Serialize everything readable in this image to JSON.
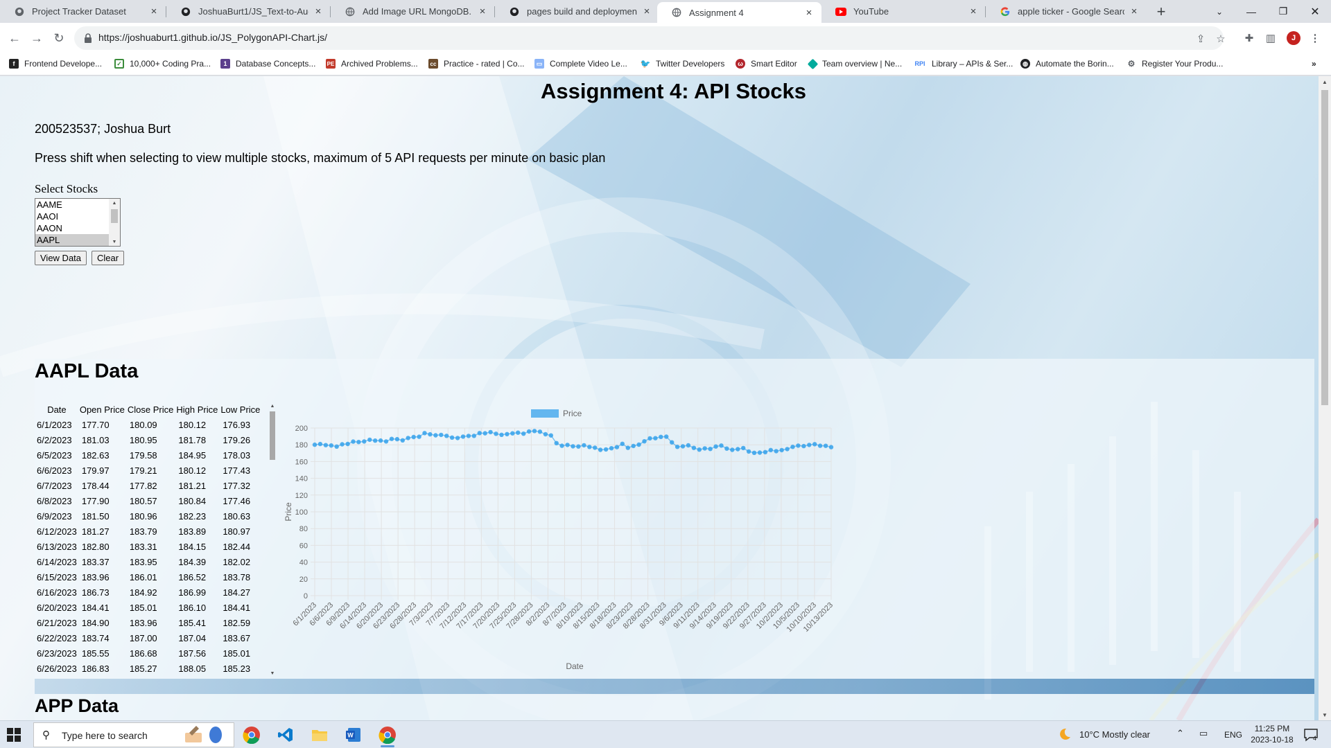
{
  "browser": {
    "tabs": [
      {
        "title": "Project Tracker Dataset",
        "icon": "github-icon"
      },
      {
        "title": "JoshuaBurt1/JS_Text-to-Audio:",
        "icon": "github-icon"
      },
      {
        "title": "Add Image URL MongoDB.",
        "icon": "globe-icon"
      },
      {
        "title": "pages build and deployment · J",
        "icon": "github-icon"
      },
      {
        "title": "Assignment 4",
        "icon": "globe-icon"
      },
      {
        "title": "YouTube",
        "icon": "youtube-icon"
      },
      {
        "title": "apple ticker - Google Search",
        "icon": "google-icon"
      }
    ],
    "active_tab_index": 4,
    "url": "https://joshuaburt1.github.io/JS_PolygonAPI-Chart.js/",
    "profile_initial": "J",
    "bookmarks": [
      "Frontend Develope...",
      "10,000+ Coding Pra...",
      "Database Concepts...",
      "Archived Problems...",
      "Practice - rated | Co...",
      "Complete Video Le...",
      "Twitter Developers",
      "Smart Editor",
      "Team overview | Ne...",
      "Library – APIs & Ser...",
      "Automate the Borin...",
      "Register Your Produ..."
    ]
  },
  "page": {
    "title": "Assignment 4: API Stocks",
    "student": "200523537; Joshua Burt",
    "instructions": "Press shift when selecting to view multiple stocks, maximum of 5 API requests per minute on basic plan",
    "select_label": "Select Stocks",
    "stock_options": [
      "AAME",
      "AAOI",
      "AAON",
      "AAPL"
    ],
    "selected_option": "AAPL",
    "view_button": "View Data",
    "clear_button": "Clear",
    "section_title": "AAPL Data",
    "next_section_title": "APP Data",
    "table": {
      "headers": [
        "Date",
        "Open Price",
        "Close Price",
        "High Price",
        "Low Price"
      ],
      "rows": [
        [
          "6/1/2023",
          "177.70",
          "180.09",
          "180.12",
          "176.93"
        ],
        [
          "6/2/2023",
          "181.03",
          "180.95",
          "181.78",
          "179.26"
        ],
        [
          "6/5/2023",
          "182.63",
          "179.58",
          "184.95",
          "178.03"
        ],
        [
          "6/6/2023",
          "179.97",
          "179.21",
          "180.12",
          "177.43"
        ],
        [
          "6/7/2023",
          "178.44",
          "177.82",
          "181.21",
          "177.32"
        ],
        [
          "6/8/2023",
          "177.90",
          "180.57",
          "180.84",
          "177.46"
        ],
        [
          "6/9/2023",
          "181.50",
          "180.96",
          "182.23",
          "180.63"
        ],
        [
          "6/12/2023",
          "181.27",
          "183.79",
          "183.89",
          "180.97"
        ],
        [
          "6/13/2023",
          "182.80",
          "183.31",
          "184.15",
          "182.44"
        ],
        [
          "6/14/2023",
          "183.37",
          "183.95",
          "184.39",
          "182.02"
        ],
        [
          "6/15/2023",
          "183.96",
          "186.01",
          "186.52",
          "183.78"
        ],
        [
          "6/16/2023",
          "186.73",
          "184.92",
          "186.99",
          "184.27"
        ],
        [
          "6/20/2023",
          "184.41",
          "185.01",
          "186.10",
          "184.41"
        ],
        [
          "6/21/2023",
          "184.90",
          "183.96",
          "185.41",
          "182.59"
        ],
        [
          "6/22/2023",
          "183.74",
          "187.00",
          "187.04",
          "183.67"
        ],
        [
          "6/23/2023",
          "185.55",
          "186.68",
          "187.56",
          "185.01"
        ],
        [
          "6/26/2023",
          "186.83",
          "185.27",
          "188.05",
          "185.23"
        ]
      ]
    }
  },
  "chart_data": {
    "type": "line",
    "legend": "Price",
    "legend_position": "top",
    "xlabel": "Date",
    "ylabel": "Price",
    "ylim": [
      0,
      200
    ],
    "yticks": [
      0,
      20,
      40,
      60,
      80,
      100,
      120,
      140,
      160,
      180,
      200
    ],
    "x_tick_labels": [
      "6/1/2023",
      "6/6/2023",
      "6/9/2023",
      "6/14/2023",
      "6/20/2023",
      "6/23/2023",
      "6/28/2023",
      "7/3/2023",
      "7/7/2023",
      "7/12/2023",
      "7/17/2023",
      "7/20/2023",
      "7/25/2023",
      "7/28/2023",
      "8/2/2023",
      "8/7/2023",
      "8/10/2023",
      "8/15/2023",
      "8/18/2023",
      "8/23/2023",
      "8/28/2023",
      "8/31/2023",
      "9/6/2023",
      "9/11/2023",
      "9/14/2023",
      "9/19/2023",
      "9/22/2023",
      "9/27/2023",
      "10/2/2023",
      "10/5/2023",
      "10/10/2023",
      "10/13/2023"
    ],
    "grid": true,
    "color": "#36a2eb",
    "series": [
      {
        "name": "Price",
        "values": [
          180.09,
          180.95,
          179.58,
          179.21,
          177.82,
          180.57,
          180.96,
          183.79,
          183.31,
          183.95,
          186.01,
          184.92,
          185.01,
          183.96,
          187.0,
          186.68,
          185.27,
          188.06,
          189.25,
          189.59,
          193.97,
          192.46,
          191.33,
          191.81,
          190.68,
          188.61,
          188.08,
          189.77,
          190.54,
          190.69,
          193.99,
          193.73,
          195.1,
          193.13,
          191.94,
          192.75,
          193.62,
          194.5,
          193.22,
          195.83,
          196.45,
          195.61,
          192.58,
          191.17,
          181.99,
          178.85,
          179.8,
          178.19,
          177.97,
          179.46,
          177.45,
          176.57,
          174.0,
          174.49,
          175.84,
          177.23,
          181.12,
          176.38,
          178.61,
          180.19,
          184.12,
          187.65,
          187.87,
          189.46,
          189.7,
          182.91,
          177.56,
          178.18,
          179.36,
          176.3,
          174.21,
          175.74,
          175.01,
          177.97,
          179.07,
          175.49,
          173.93,
          174.79,
          176.08,
          171.96,
          170.43,
          170.69,
          171.21,
          173.75,
          172.4,
          173.66,
          174.91,
          177.49,
          178.99,
          178.39,
          179.8,
          180.71,
          178.85,
          178.72,
          177.15
        ]
      }
    ]
  },
  "taskbar": {
    "search_placeholder": "Type here to search",
    "weather": "10°C  Mostly clear",
    "language": "ENG",
    "time": "11:25 PM",
    "date": "2023-10-18",
    "notifications": "4"
  }
}
